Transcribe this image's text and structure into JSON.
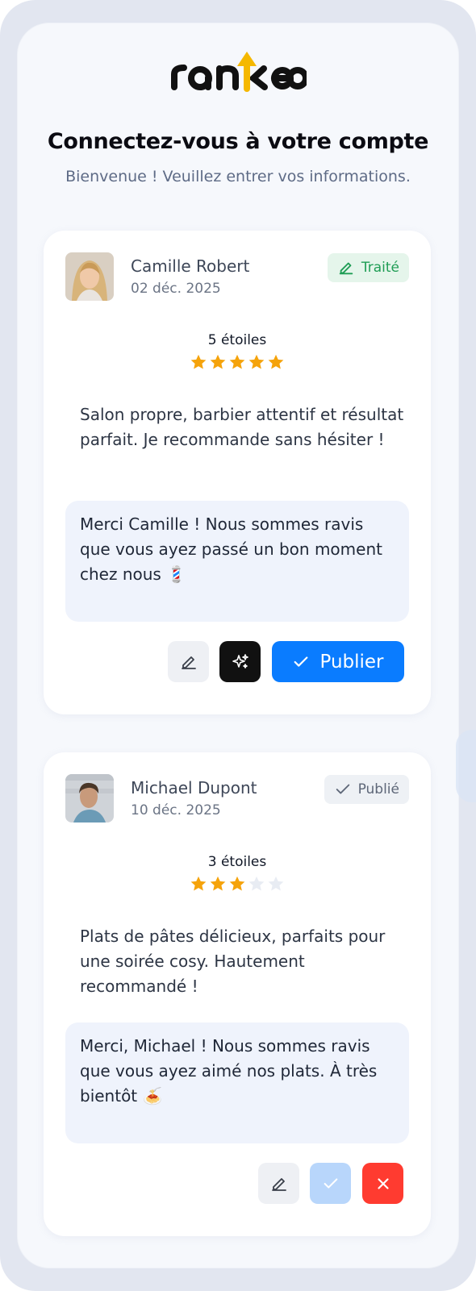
{
  "brand": {
    "logo_text": "rankeo"
  },
  "header": {
    "title": "Connectez-vous à votre compte",
    "subtitle": "Bienvenue ! Veuillez entrer vos informations."
  },
  "reviews": [
    {
      "author": "Camille Robert",
      "date": "02 déc. 2025",
      "status": "Traité",
      "rating_label": "5 étoiles",
      "rating": 5,
      "text": "Salon propre, barbier attentif et résultat parfait. Je recommande sans hésiter !",
      "reply": "Merci Camille ! Nous sommes ravis que vous ayez passé un bon moment chez nous 💈",
      "publish_label": "Publier"
    },
    {
      "author": "Michael Dupont",
      "date": "10 déc. 2025",
      "status": "Publié",
      "rating_label": "3 étoiles",
      "rating": 3,
      "text": "Plats de pâtes délicieux, parfaits pour une soirée cosy. Hautement recommandé !",
      "reply": "Merci, Michael ! Nous sommes ravis que vous ayez aimé nos plats. À très bientôt 🍝"
    }
  ],
  "colors": {
    "accent": "#0a7cff",
    "star": "#f5a30b",
    "star_empty": "#e8ecf3",
    "success": "#1f9d55",
    "danger": "#ff3b30"
  }
}
